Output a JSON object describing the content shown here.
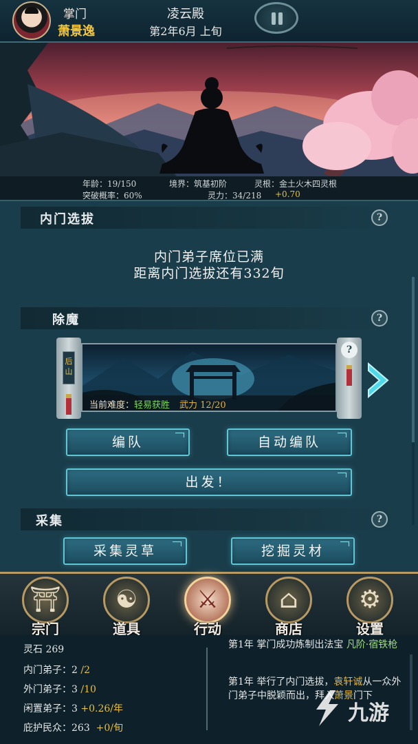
{
  "header": {
    "role": "掌门",
    "leader_name": "萧景逸",
    "hall": "凌云殿",
    "date": "第2年6月 上旬"
  },
  "stats": {
    "age": "年龄：19/150",
    "realm": "境界：筑基初阶",
    "spirit_root": "灵根：金土火木四灵根",
    "breakthrough": "突破概率：60%",
    "spiritual_power": "灵力：34/218",
    "power_rate": "+0.70"
  },
  "sections": {
    "inner_selection": {
      "title": "内门选拔",
      "line1": "内门弟子席位已满",
      "line2": "距离内门选拔还有332旬"
    },
    "demon_slaying": {
      "title": "除魔",
      "location": "后山",
      "difficulty_label": "当前难度：",
      "difficulty_value": "轻易获胜",
      "force": "武力 12/20",
      "team_btn": "编队",
      "auto_team_btn": "自动编队",
      "depart_btn": "出发！"
    },
    "gathering": {
      "title": "采集",
      "herb_btn": "采集灵草",
      "ore_btn": "挖掘灵材"
    }
  },
  "help_icon": "?",
  "nav": [
    {
      "label": "宗门",
      "icon": "sect-gate-icon",
      "glyph": "⛩"
    },
    {
      "label": "道具",
      "icon": "pouch-icon",
      "glyph": "☯"
    },
    {
      "label": "行动",
      "icon": "sword-scroll-icon",
      "glyph": "⚔"
    },
    {
      "label": "商店",
      "icon": "shop-icon",
      "glyph": "⌂"
    },
    {
      "label": "设置",
      "icon": "gear-icon",
      "glyph": "⚙"
    }
  ],
  "resources": {
    "spirit_stone": "灵石 269",
    "inner_label": "内门弟子：2",
    "inner_cap": "/2",
    "outer_label": "外门弟子：3",
    "outer_cap": "/10",
    "idle_label": "闲置弟子：3",
    "idle_rate": "+0.26/年",
    "protected_label": "庇护民众：263",
    "protected_rate": "+0/旬"
  },
  "log": {
    "entry1_prefix": "第1年  掌门成功炼制出法宝",
    "entry1_item": "凡阶·宿铁枪",
    "entry2_prefix": "第1年  举行了内门选拔，",
    "entry2_name": "袁轩诚",
    "entry2_mid": "从一众外门弟子中脱颖而出，拜入",
    "entry2_name2": "萧景",
    "entry2_suffix": "门下"
  },
  "watermark": {
    "text": "九游"
  },
  "colors": {
    "accent_gold": "#e8c04a",
    "button_border": "#5fc7d6",
    "panel_bg": "#1a3d4b",
    "success_green": "#7ed65a"
  }
}
